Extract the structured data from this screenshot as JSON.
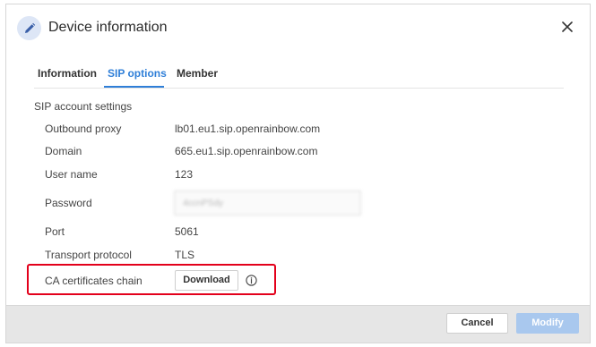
{
  "dialog": {
    "title": "Device information",
    "icons": {
      "header": "pencil-icon",
      "close": "close-icon",
      "info": "info-icon"
    }
  },
  "tabs": [
    {
      "label": "Information",
      "active": false
    },
    {
      "label": "SIP options",
      "active": true
    },
    {
      "label": "Member",
      "active": false
    }
  ],
  "section": {
    "title": "SIP account settings"
  },
  "fields": {
    "outbound_proxy": {
      "label": "Outbound proxy",
      "value": "lb01.eu1.sip.openrainbow.com"
    },
    "domain": {
      "label": "Domain",
      "value": "665.eu1.sip.openrainbow.com"
    },
    "user_name": {
      "label": "User name",
      "value": "123"
    },
    "password": {
      "label": "Password",
      "value": "4ccnPSdy"
    },
    "port": {
      "label": "Port",
      "value": "5061"
    },
    "transport": {
      "label": "Transport protocol",
      "value": "TLS"
    },
    "ca_chain": {
      "label": "CA certificates chain",
      "button": "Download"
    }
  },
  "footer": {
    "cancel": "Cancel",
    "modify": "Modify"
  },
  "colors": {
    "accent": "#2f7fd8",
    "highlight": "#e3001b",
    "disabled": "#a9c8ee"
  }
}
